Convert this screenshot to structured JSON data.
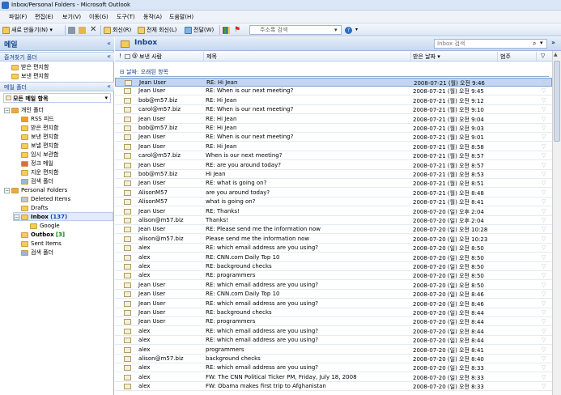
{
  "window": {
    "title": "Inbox/Personal Folders - Microsoft Outlook"
  },
  "menu": [
    "파일(F)",
    "편집(E)",
    "보기(V)",
    "이동(G)",
    "도구(T)",
    "동작(A)",
    "도움말(H)"
  ],
  "toolbar": {
    "new_label": "새로 만들기(N)",
    "reply_label": "회신(R)",
    "reply_all_label": "전체 회신(L)",
    "forward_label": "전달(W)",
    "search_placeholder": "주소록 검색"
  },
  "nav": {
    "title": "메일",
    "favorites_header": "즐겨찾기 폴더",
    "favorites": [
      "받은 편지함",
      "보낸 편지함"
    ],
    "mail_folders_header": "메일 폴더",
    "all_mail_label": "모든 메일 항목",
    "personal_root": "개인 폴더",
    "personal_items": [
      "RSS 피드",
      "받은 편지함",
      "보낸 편지함",
      "보낼 편지함",
      "임시 보관함",
      "정크 메일",
      "지운 편지함",
      "검색 폴더"
    ],
    "pf_root": "Personal Folders",
    "pf_deleted": "Deleted Items",
    "pf_drafts": "Drafts",
    "pf_inbox": "Inbox",
    "pf_inbox_count": "(137)",
    "pf_google": "Google",
    "pf_outbox": "Outbox",
    "pf_outbox_count": "[3]",
    "pf_sent": "Sent Items",
    "pf_search": "검색 폴더"
  },
  "main": {
    "title": "Inbox",
    "search_placeholder": "Inbox 검색",
    "col_from": "보낸 사람",
    "col_subject": "제목",
    "col_received": "받은 날짜",
    "col_category": "범주",
    "group_label": "날짜: 오래된 항목"
  },
  "messages": [
    {
      "from": "Jean User",
      "subject": "RE: Hi Jean",
      "received": "2008-07-21 (월) 오전 9:46"
    },
    {
      "from": "Jean User",
      "subject": "RE: When is our next meeting?",
      "received": "2008-07-21 (월) 오전 9:45"
    },
    {
      "from": "bob@m57.biz",
      "subject": "RE: Hi Jean",
      "received": "2008-07-21 (월) 오전 9:12"
    },
    {
      "from": "carol@m57.biz",
      "subject": "RE: When is our next meeting?",
      "received": "2008-07-21 (월) 오전 9:10"
    },
    {
      "from": "Jean User",
      "subject": "RE: Hi Jean",
      "received": "2008-07-21 (월) 오전 9:04"
    },
    {
      "from": "bob@m57.biz",
      "subject": "RE: Hi Jean",
      "received": "2008-07-21 (월) 오전 9:03"
    },
    {
      "from": "Jean User",
      "subject": "RE: When is our next meeting?",
      "received": "2008-07-21 (월) 오전 9:01"
    },
    {
      "from": "Jean User",
      "subject": "RE: Hi Jean",
      "received": "2008-07-21 (월) 오전 8:58"
    },
    {
      "from": "carol@m57.biz",
      "subject": "When is our next meeting?",
      "received": "2008-07-21 (월) 오전 8:57"
    },
    {
      "from": "Jean User",
      "subject": "RE: are you around today?",
      "received": "2008-07-21 (월) 오전 8:57"
    },
    {
      "from": "bob@m57.biz",
      "subject": "Hi Jean",
      "received": "2008-07-21 (월) 오전 8:53"
    },
    {
      "from": "Jean User",
      "subject": "RE: what is going on?",
      "received": "2008-07-21 (월) 오전 8:51"
    },
    {
      "from": "AlisonM57",
      "subject": "are you around today?",
      "received": "2008-07-21 (월) 오전 8:48"
    },
    {
      "from": "AlisonM57",
      "subject": "what is going on?",
      "received": "2008-07-21 (월) 오전 8:41"
    },
    {
      "from": "Jean User",
      "subject": "RE: Thanks!",
      "received": "2008-07-20 (일) 오후 2:04"
    },
    {
      "from": "alison@m57.biz",
      "subject": "Thanks!",
      "received": "2008-07-20 (일) 오후 2:04"
    },
    {
      "from": "Jean User",
      "subject": "RE: Please send me the information now",
      "received": "2008-07-20 (일) 오전 10:28"
    },
    {
      "from": "alison@m57.biz",
      "subject": "Please send me the information now",
      "received": "2008-07-20 (일) 오전 10:23"
    },
    {
      "from": "alex",
      "subject": "RE: which email address are you using?",
      "received": "2008-07-20 (일) 오전 8:50"
    },
    {
      "from": "alex",
      "subject": "RE: CNN.com Daily Top 10",
      "received": "2008-07-20 (일) 오전 8:50"
    },
    {
      "from": "alex",
      "subject": "RE: background checks",
      "received": "2008-07-20 (일) 오전 8:50"
    },
    {
      "from": "alex",
      "subject": "RE: programmers",
      "received": "2008-07-20 (일) 오전 8:50"
    },
    {
      "from": "Jean User",
      "subject": "RE: which email address are you using?",
      "received": "2008-07-20 (일) 오전 8:50"
    },
    {
      "from": "Jean User",
      "subject": "RE: CNN.com Daily Top 10",
      "received": "2008-07-20 (일) 오전 8:46"
    },
    {
      "from": "Jean User",
      "subject": "RE: which email address are you using?",
      "received": "2008-07-20 (일) 오전 8:46"
    },
    {
      "from": "Jean User",
      "subject": "RE: background checks",
      "received": "2008-07-20 (일) 오전 8:44"
    },
    {
      "from": "Jean User",
      "subject": "RE: programmers",
      "received": "2008-07-20 (일) 오전 8:44"
    },
    {
      "from": "alex",
      "subject": "RE: which email address are you using?",
      "received": "2008-07-20 (일) 오전 8:44"
    },
    {
      "from": "alex",
      "subject": "RE: which email address are you using?",
      "received": "2008-07-20 (일) 오전 8:44"
    },
    {
      "from": "alex",
      "subject": "programmers",
      "received": "2008-07-20 (일) 오전 8:41"
    },
    {
      "from": "alison@m57.biz",
      "subject": "background checks",
      "received": "2008-07-20 (일) 오전 8:40"
    },
    {
      "from": "alex",
      "subject": "RE: which email address are you using?",
      "received": "2008-07-20 (일) 오전 8:33"
    },
    {
      "from": "alex",
      "subject": "FW: The CNN Political Ticker PM, Friday, July 18, 2008",
      "received": "2008-07-20 (일) 오전 8:33"
    },
    {
      "from": "alex",
      "subject": "FW: Obama makes first trip to Afghanistan",
      "received": "2008-07-20 (일) 오전 8:33"
    }
  ]
}
